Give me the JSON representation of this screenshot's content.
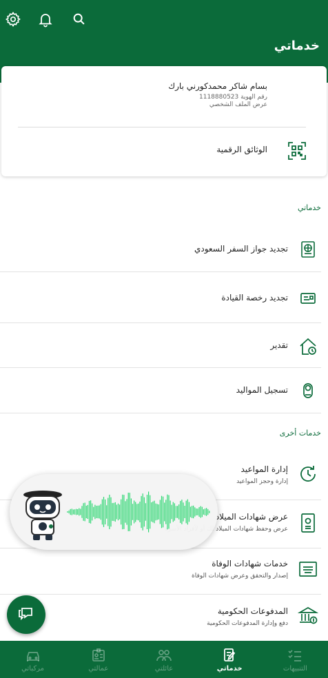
{
  "header": {
    "title": "خدماتي",
    "icons": [
      "gear-icon",
      "bell-icon",
      "search-icon"
    ]
  },
  "profile": {
    "name": "بسام شاكر محمدكورني بارك",
    "id_label": "رقم الهوية 1118880523",
    "view_profile": "عرض الملف الشخصي",
    "digital_docs": "الوثائق الرقمية"
  },
  "sections": {
    "my_services": "خدماتي",
    "other_services": "خدمات أخرى"
  },
  "services": [
    {
      "title": "تجديد جواز السفر السعودي",
      "icon": "passport-icon"
    },
    {
      "title": "تجديد رخصة القيادة",
      "icon": "license-icon"
    },
    {
      "title": "تقدير",
      "icon": "house-clock-icon"
    },
    {
      "title": "تسجيل المواليد",
      "icon": "baby-icon"
    }
  ],
  "other_services": [
    {
      "title": "إدارة المواعيد",
      "subtitle": "إدارة وحجز المواعيد",
      "icon": "clock-arrow-icon"
    },
    {
      "title": "عرض شهادات الميلاد",
      "subtitle": "عرض وحفظ شهادات الميلاد لك أو لأفراد الأسرة",
      "icon": "birth-certificate-icon"
    },
    {
      "title": "خدمات شهادات الوفاة",
      "subtitle": "إصدار والتحقق وعرض شهادات الوفاة",
      "icon": "death-certificate-icon"
    },
    {
      "title": "المدفوعات الحكومية",
      "subtitle": "دفع وإدارة المدفوعات الحكومية",
      "icon": "government-building-icon"
    }
  ],
  "nav": [
    {
      "label": "التنبيهات",
      "icon": "checklist-icon",
      "active": false
    },
    {
      "label": "خدماتي",
      "icon": "document-pen-icon",
      "active": true
    },
    {
      "label": "عائلتي",
      "icon": "family-icon",
      "active": false
    },
    {
      "label": "عمالتي",
      "icon": "id-badge-icon",
      "active": false
    },
    {
      "label": "مركباتي",
      "icon": "car-icon",
      "active": false
    }
  ],
  "colors": {
    "brand_green": "#0b6b3a",
    "wave_green": "#22d66b"
  }
}
